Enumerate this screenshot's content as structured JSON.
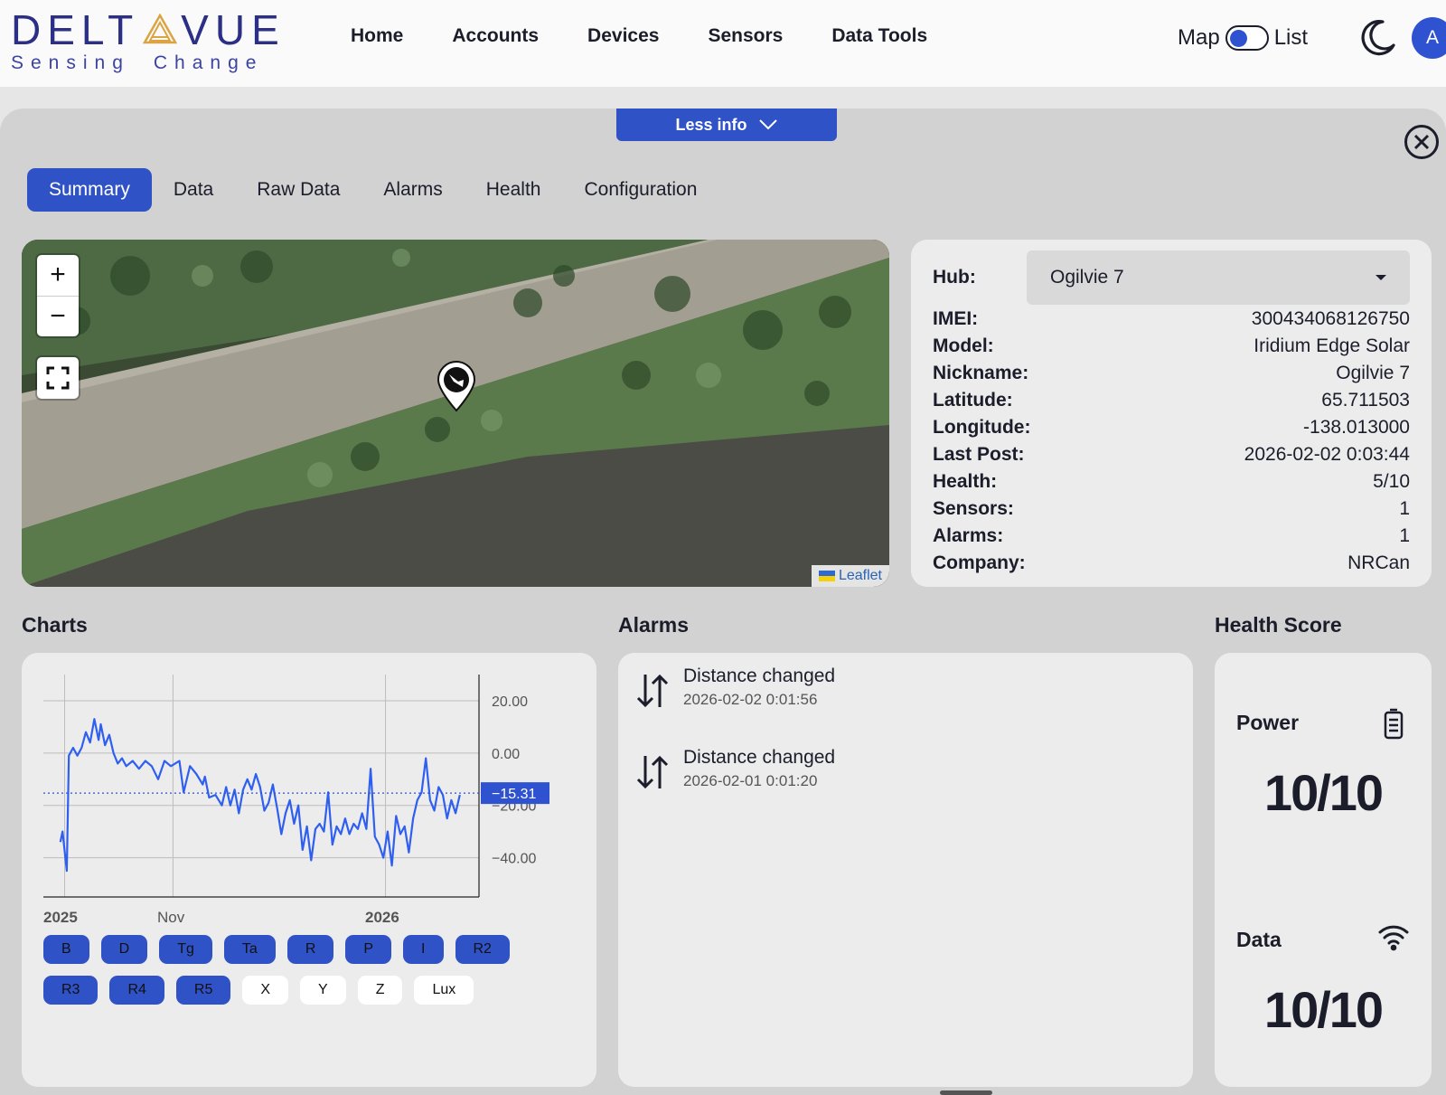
{
  "logo": {
    "main_left": "DELT",
    "main_right": "VUE",
    "tagline_1": "Sensing",
    "tagline_2": "Change"
  },
  "nav": [
    "Home",
    "Accounts",
    "Devices",
    "Sensors",
    "Data Tools"
  ],
  "view_toggle": {
    "left": "Map",
    "right": "List"
  },
  "avatar": "A",
  "less_info": "Less info",
  "tabs": [
    "Summary",
    "Data",
    "Raw Data",
    "Alarms",
    "Health",
    "Configuration"
  ],
  "map": {
    "attribution": "Leaflet"
  },
  "hub": {
    "label": "Hub:",
    "selected": "Ogilvie 7"
  },
  "fields": [
    {
      "k": "IMEI:",
      "v": "300434068126750"
    },
    {
      "k": "Model:",
      "v": "Iridium Edge Solar"
    },
    {
      "k": "Nickname:",
      "v": "Ogilvie 7"
    },
    {
      "k": "Latitude:",
      "v": "65.711503"
    },
    {
      "k": "Longitude:",
      "v": "-138.013000"
    },
    {
      "k": "Last Post:",
      "v": "2026-02-02 0:03:44"
    },
    {
      "k": "Health:",
      "v": "5/10"
    },
    {
      "k": "Sensors:",
      "v": "1"
    },
    {
      "k": "Alarms:",
      "v": "1"
    },
    {
      "k": "Company:",
      "v": "NRCan"
    }
  ],
  "sections": {
    "charts": "Charts",
    "alarms": "Alarms",
    "health": "Health Score"
  },
  "chart_data": {
    "type": "line",
    "ytick_labels": [
      "20.00",
      "0.00",
      "−20.00",
      "−40.00"
    ],
    "yticks": [
      20,
      0,
      -20,
      -40
    ],
    "ylim": [
      -55,
      30
    ],
    "xtick_labels": [
      "2025",
      "Nov",
      "2026"
    ],
    "xticks": [
      2,
      53,
      153
    ],
    "xlim": [
      -8,
      197
    ],
    "current_value_label": "−15.31",
    "current_value": -15.31,
    "series": [
      {
        "x": [
          0,
          1,
          3,
          4,
          6,
          8,
          10,
          12,
          14,
          16,
          18,
          19,
          21,
          23,
          25,
          27,
          29,
          31,
          34,
          37,
          40,
          43,
          46,
          49,
          52,
          54,
          56,
          58,
          61,
          64,
          67,
          68,
          70,
          73,
          76,
          78,
          80,
          82,
          84,
          86,
          88,
          90,
          92,
          94,
          96,
          98,
          100,
          102,
          104,
          106,
          108,
          110,
          112,
          114,
          116,
          118,
          120,
          122,
          124,
          126,
          128,
          130,
          132,
          134,
          136,
          138,
          140,
          142,
          144,
          146,
          148,
          150,
          152,
          154,
          156,
          158,
          160,
          162,
          164,
          166,
          168,
          170,
          172,
          174,
          176,
          178,
          180,
          182,
          184,
          186,
          188
        ],
        "y": [
          -34,
          -30,
          -45,
          -1,
          2,
          -1,
          2,
          8,
          4,
          13,
          5,
          11,
          3,
          7,
          0,
          -4,
          -2,
          -5,
          -3,
          -6,
          -3,
          -5,
          -10,
          -3,
          -5,
          -4,
          -3,
          -15,
          -5,
          -8,
          -12,
          -9,
          -17,
          -16,
          -20,
          -13,
          -20,
          -14,
          -23,
          -14,
          -10,
          -14,
          -8,
          -13,
          -22,
          -19,
          -12,
          -21,
          -31,
          -23,
          -18,
          -27,
          -20,
          -37,
          -28,
          -41,
          -29,
          -27,
          -30,
          -15,
          -35,
          -28,
          -31,
          -25,
          -31,
          -27,
          -29,
          -23,
          -29,
          -6,
          -32,
          -35,
          -40,
          -30,
          -43,
          -24,
          -31,
          -28,
          -38,
          -25,
          -18,
          -15,
          -2,
          -18,
          -22,
          -13,
          -16,
          -25,
          -18,
          -23,
          -16
        ]
      }
    ]
  },
  "chips": {
    "row1": [
      {
        "l": "B",
        "on": true
      },
      {
        "l": "D",
        "on": true
      },
      {
        "l": "Tg",
        "on": true
      },
      {
        "l": "Ta",
        "on": true
      },
      {
        "l": "R",
        "on": true
      },
      {
        "l": "P",
        "on": true
      },
      {
        "l": "I",
        "on": true
      },
      {
        "l": "R2",
        "on": true
      }
    ],
    "row2": [
      {
        "l": "R3",
        "on": true
      },
      {
        "l": "R4",
        "on": true
      },
      {
        "l": "R5",
        "on": true
      },
      {
        "l": "X",
        "on": false
      },
      {
        "l": "Y",
        "on": false
      },
      {
        "l": "Z",
        "on": false
      },
      {
        "l": "Lux",
        "on": false
      }
    ]
  },
  "alarms": [
    {
      "title": "Distance changed",
      "time": "2026-02-02 0:01:56"
    },
    {
      "title": "Distance changed",
      "time": "2026-02-01 0:01:20"
    }
  ],
  "health": {
    "power_label": "Power",
    "power_score": "10/10",
    "data_label": "Data",
    "data_score": "10/10"
  },
  "colors": {
    "accent": "#3052c7",
    "line": "#2f5ff0",
    "brand": "#2b2f86",
    "logo_gold": "#d9a441"
  }
}
